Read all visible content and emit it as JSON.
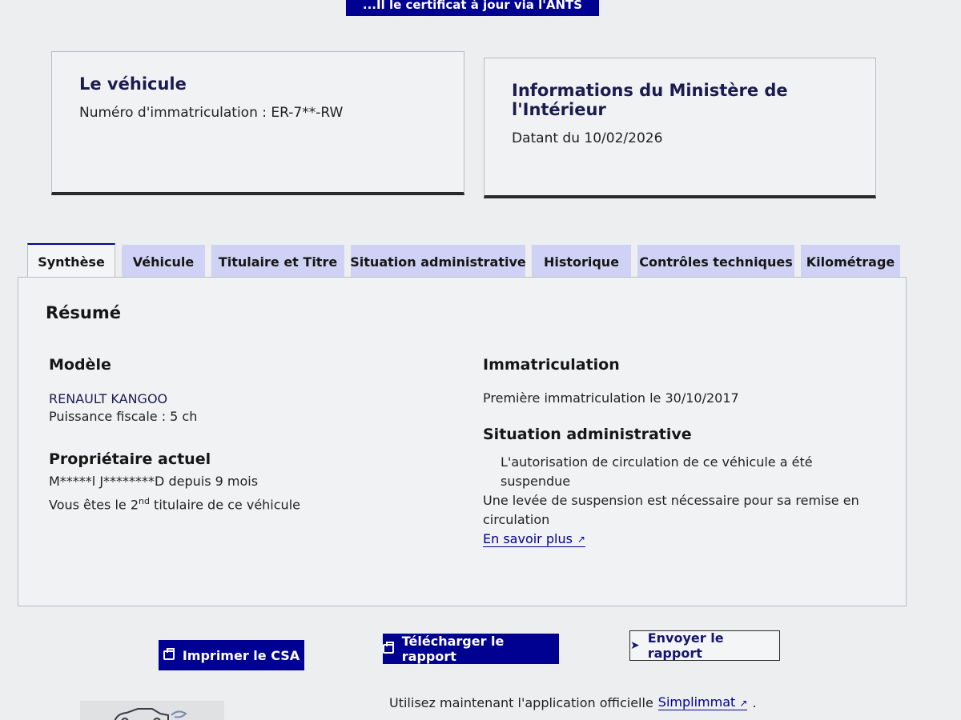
{
  "top_button": {
    "label": "...Il le certificat à jour via l'ANTS"
  },
  "vehicle_card": {
    "title": "Le véhicule",
    "plate_label": "Numéro d'immatriculation : ER-7**-RW"
  },
  "ministry_card": {
    "title": "Informations du Ministère de l'Intérieur",
    "date_text": "Datant du 10/02/2026"
  },
  "tabs": [
    {
      "label": "Synthèse",
      "active": true
    },
    {
      "label": "Véhicule"
    },
    {
      "label": "Titulaire et Titre"
    },
    {
      "label": "Situation administrative"
    },
    {
      "label": "Historique"
    },
    {
      "label": "Contrôles techniques"
    },
    {
      "label": "Kilométrage"
    }
  ],
  "summary": {
    "title": "Résumé",
    "model": {
      "heading": "Modèle",
      "name": "RENAULT KANGOO",
      "fiscal_power": "Puissance fiscale : 5 ch"
    },
    "owner": {
      "heading": "Propriétaire actuel",
      "name_since": "M*****l J********D depuis 9 mois",
      "holder_prefix": "Vous êtes le 2",
      "holder_sup": "nd",
      "holder_suffix": " titulaire de ce véhicule"
    },
    "registration": {
      "heading": "Immatriculation",
      "first_registration": "Première immatriculation le 30/10/2017"
    },
    "admin": {
      "heading": "Situation administrative",
      "line1": "L'autorisation de circulation de ce véhicule a été suspendue",
      "line2": "Une levée de suspension est nécessaire pour sa remise en circulation",
      "link": "En savoir plus"
    }
  },
  "actions": {
    "print": "Imprimer le CSA",
    "download": "Télécharger le rapport",
    "send": "Envoyer le rapport"
  },
  "footer": {
    "text": "Utilisez maintenant l'application officielle",
    "link": "Simplimmat",
    "end": "."
  }
}
